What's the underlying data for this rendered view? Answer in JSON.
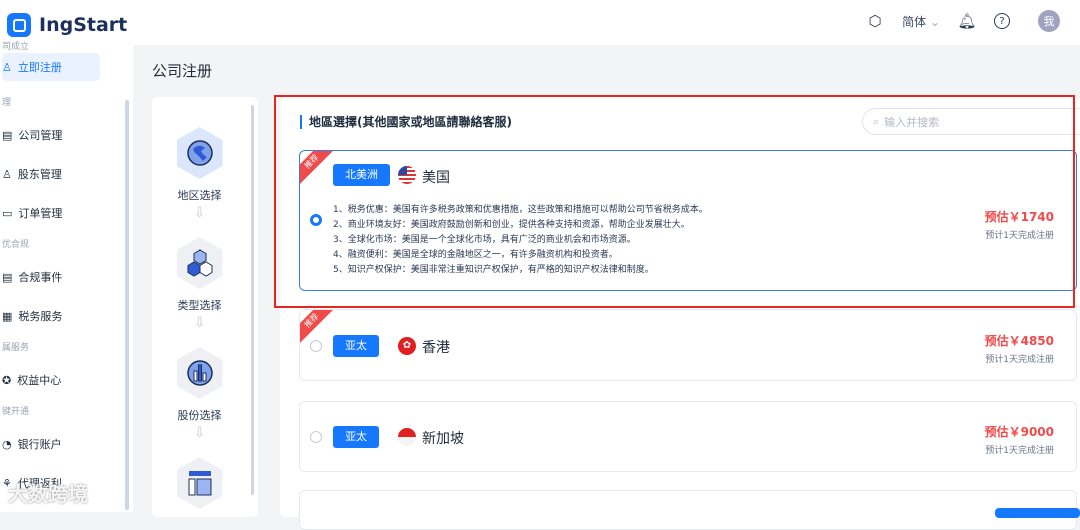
{
  "app": {
    "name": "IngStart"
  },
  "header": {
    "language": "简体",
    "avatar": "我"
  },
  "sidebar": {
    "groups": [
      {
        "label": "司成立",
        "items": [
          {
            "label": "立即注册",
            "active": true
          }
        ]
      },
      {
        "label": "理",
        "items": [
          {
            "label": "公司管理"
          },
          {
            "label": "股东管理"
          },
          {
            "label": "订单管理"
          }
        ]
      },
      {
        "label": "优合规",
        "items": [
          {
            "label": "合规事件"
          },
          {
            "label": "税务服务"
          }
        ]
      },
      {
        "label": "属服务",
        "items": [
          {
            "label": "权益中心"
          }
        ]
      },
      {
        "label": "键开通",
        "items": [
          {
            "label": "银行账户"
          },
          {
            "label": "代理返利"
          }
        ]
      }
    ]
  },
  "page": {
    "title": "公司注册"
  },
  "steps": [
    {
      "label": "地区选择"
    },
    {
      "label": "类型选择"
    },
    {
      "label": "股份选择"
    },
    {
      "label": ""
    }
  ],
  "region": {
    "title": "地區選擇(其他國家或地區請聯絡客服)",
    "search_placeholder": "输入并搜索"
  },
  "cards": [
    {
      "ribbon": "推荐",
      "region": "北美洲",
      "country": "美国",
      "selected": true,
      "price": "预估￥1740",
      "eta": "预计1天完成注册",
      "desc": [
        "1、税务优惠：美国有许多税务政策和优惠措施，这些政策和措施可以帮助公司节省税务成本。",
        "2、商业环境友好：美国政府鼓励创新和创业，提供各种支持和资源，帮助企业发展壮大。",
        "3、全球化市场：美国是一个全球化市场，具有广泛的商业机会和市场资源。",
        "4、融资便利：美国是全球的金融地区之一，有许多融资机构和投资者。",
        "5、知识产权保护：美国非常注重知识产权保护，有严格的知识产权法律和制度。"
      ]
    },
    {
      "ribbon": "推荐",
      "region": "亚太",
      "country": "香港",
      "selected": false,
      "price": "预估￥4850",
      "eta": "预计1天完成注册"
    },
    {
      "region": "亚太",
      "country": "新加坡",
      "selected": false,
      "price": "预估￥9000",
      "eta": "预计1天完成注册"
    }
  ],
  "watermark": "大数跨境",
  "colors": {
    "accent": "#1677ff",
    "price": "#f04b4b",
    "annotation": "#e8261f"
  }
}
